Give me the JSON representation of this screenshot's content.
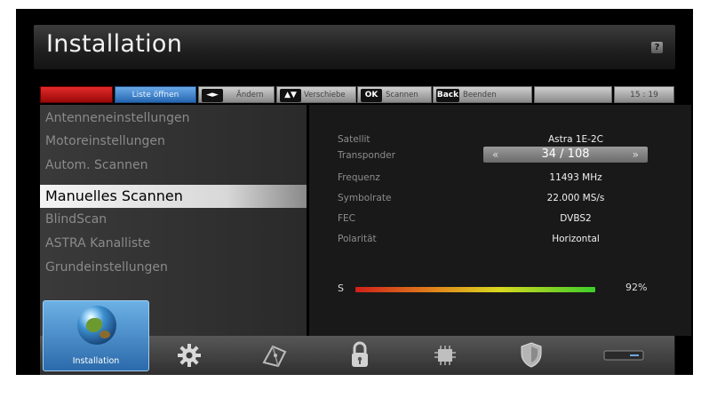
{
  "header": {
    "title": "Installation",
    "help_icon": "help-icon"
  },
  "keybar": {
    "blue_label": "Liste öffnen",
    "lr_key": "◄►",
    "lr_label": "Ändern",
    "ud_key": "▲▼",
    "ud_label": "Verschiebe",
    "ok_key": "OK",
    "ok_label": "Scannen",
    "back_key": "Back",
    "back_label": "Beenden",
    "clock": "15 : 19"
  },
  "menu": {
    "items": [
      "Antenneneinstellungen",
      "Motoreinstellungen",
      "Autom. Scannen",
      "Manuelles Scannen",
      "BlindScan",
      "ASTRA Kanalliste",
      "Grundeinstellungen"
    ],
    "active_index": 3
  },
  "settings": {
    "satellit_label": "Satellit",
    "satellit_value": "Astra 1E-2C",
    "transponder_label": "Transponder",
    "transponder_value": "34 / 108",
    "transponder_left": "«",
    "transponder_right": "»",
    "frequenz_label": "Frequenz",
    "frequenz_value": "11493 MHz",
    "symbolrate_label": "Symbolrate",
    "symbolrate_value": "22.000 MS/s",
    "fec_label": "FEC",
    "fec_value": "DVBS2",
    "polaritaet_label": "Polarität",
    "polaritaet_value": "Horizontal"
  },
  "signal": {
    "label": "S",
    "percent_text": "92%",
    "level": 0.92
  },
  "dock": {
    "active_label": "Installation",
    "icons": [
      "globe-icon",
      "gear-icon",
      "satellite-dish-icon",
      "padlock-icon",
      "chip-icon",
      "shield-icon",
      "receiver-icon"
    ]
  },
  "colors": {
    "red_key": "#d41f1f",
    "blue_key": "#3b82cf",
    "active_dock": "#4b97d9"
  }
}
